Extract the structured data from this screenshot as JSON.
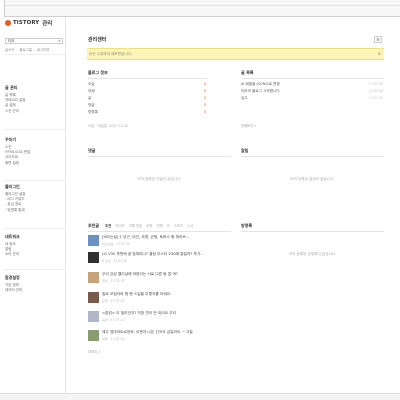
{
  "sidebar": {
    "logo_text": "TISTORY",
    "logo_sub": "관리",
    "blog_select": "티모",
    "links": [
      "글쓰기",
      "블로그홈",
      "로그아웃"
    ],
    "sections": [
      {
        "head": "글 관리",
        "items": [
          "글 목록",
          "카테고리 설정",
          "글 설정",
          "스킨 관리"
        ]
      },
      {
        "head": "꾸미기",
        "items": [
          "스킨",
          "HTML/CSS 편집",
          "사이드바",
          "화면 설정"
        ]
      },
      {
        "head": "플러그인",
        "items": [
          "플러그인 설정",
          "- 태그 키워드",
          "- 유입 경로",
          "- 방명록 통계"
        ]
      },
      {
        "head": "네트워크",
        "items": [
          "내 링크",
          "알림",
          "소리 관리"
        ]
      },
      {
        "head": "환경설정",
        "items": [
          "기본 정보",
          "데이터 관리"
        ]
      }
    ]
  },
  "main": {
    "title": "관리센터",
    "gear": "⚙",
    "notice": "이곳 수정하여 배포판입니다.",
    "notice_close": "×",
    "blog_info": {
      "title": "블로그 정보",
      "rows": [
        {
          "label": "오늘",
          "value": "0"
        },
        {
          "label": "어제",
          "value": "0"
        },
        {
          "label": "글",
          "value": "0"
        },
        {
          "label": "댓글",
          "value": "0"
        },
        {
          "label": "방명록",
          "value": "0"
        }
      ],
      "footer": "오늘 · 개설일: 2017.10.10"
    },
    "post_list": {
      "title": "글 목록",
      "rows": [
        {
          "label": "JS 배열을 JSON으로 변환",
          "date": "17.07.09"
        },
        {
          "label": "티모의 블로그 시작합니다",
          "date": "17.07.04"
        },
        {
          "label": "입고",
          "date": "17.07.02"
        }
      ],
      "more": "전체보기 »"
    },
    "comments": {
      "title": "댓글",
      "empty": "아직 등록된 댓글이 없습니다."
    },
    "alerts": {
      "title": "알림",
      "empty": "아직 등록된 알림이 없습니다."
    },
    "guestbook": {
      "title": "방명록",
      "empty": "아직 등록된 방명록이 없습니다."
    },
    "recommend": {
      "title": "추천글",
      "tabs": [
        "추천",
        "라이프",
        "여행·맛집",
        "문화",
        "연예",
        "IT",
        "스포츠",
        "시사"
      ],
      "posts": [
        {
          "title": "[비오는날] 1 당근, 비건, 초콩, 균형, 토마스 몽 파이브...",
          "meta": "비오는날 · 17.07.10",
          "thumb_color": "#6a8fc2"
        },
        {
          "title": "LG V30 후면에 꿈 탑재되나? 퀄컴 부스터 V30에 깔릴까? 후기...",
          "meta": "IT소식 · 17.07.10",
          "thumb_color": "#2f2f2f"
        },
        {
          "title": "우리 강성 엘리샬에 마음이는 서로 다른 탐 없 여?",
          "meta": "일상 · 17.07.10",
          "thumb_color": "#c9a27a"
        },
        {
          "title": "밀로 모집아와 협 맨 스킬을 이렇지를 하세요.",
          "meta": "요리 · 17.07.10",
          "thumb_color": "#7a5a4a"
        },
        {
          "title": "<훈련> 이 밀리던지? 직장 연이 만 되어요 우리",
          "meta": "육아 · 17.07.10",
          "thumb_color": "#b0b8c8"
        },
        {
          "title": "제주 엄마어트로양쑥, 이벤자 나은 신국국 금일하이 ㅡ 사찰",
          "meta": "여행 · 17.07.10",
          "thumb_color": "#8a9d6e"
        }
      ],
      "more": "더보기 »"
    }
  },
  "colors": {
    "accent": "#f05a22",
    "notice_bg": "#fdf5b8"
  }
}
